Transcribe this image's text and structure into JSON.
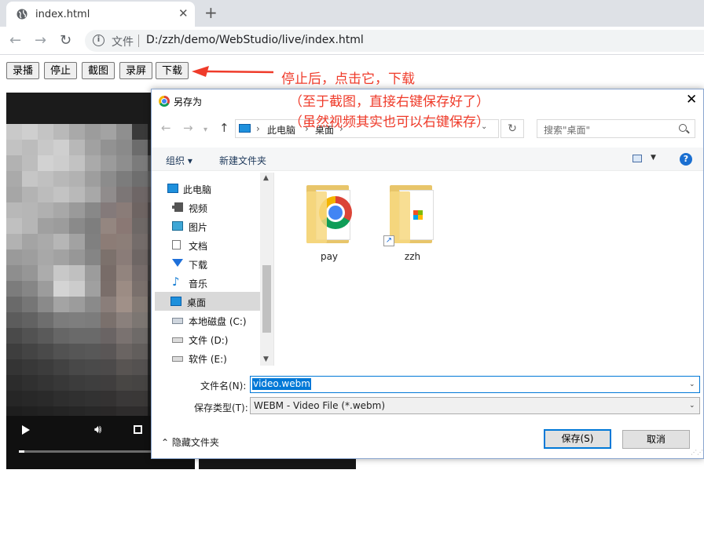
{
  "browser": {
    "tab_title": "index.html",
    "new_tab": "+",
    "scheme_label": "文件",
    "url": "D:/zzh/demo/WebStudio/live/index.html"
  },
  "page": {
    "buttons": [
      "录播",
      "停止",
      "截图",
      "录屏",
      "下载"
    ]
  },
  "annotation": {
    "lines": [
      "停止后，点击它，下载",
      "（至于截图，直接右键保存好了）",
      "（虽然视频其实也可以右键保存）"
    ],
    "color": "#ef3b2a"
  },
  "video": {
    "progress": 0.03,
    "mosaic": [
      "#c9c9c9",
      "#cfcfcf",
      "#c4c4c4",
      "#b9b9b9",
      "#a9a9a9",
      "#9c9c9c",
      "#a3a3a3",
      "#8f8f8f",
      "#3a3a3a",
      "#1c1c1c",
      "#c2c2c2",
      "#bcbcbc",
      "#c8c8c8",
      "#cfcfcf",
      "#b8b8b8",
      "#a1a1a1",
      "#929292",
      "#8a8a8a",
      "#6c6c6c",
      "#2a2a2a",
      "#b2b2b2",
      "#bdbdbd",
      "#d2d2d2",
      "#cdcdcd",
      "#c2c2c2",
      "#aaaaaa",
      "#9b9b9b",
      "#8e8e8e",
      "#7b7b7b",
      "#515151",
      "#aaaaaa",
      "#c6c6c6",
      "#c0c0c0",
      "#b8b8b8",
      "#b2b2b2",
      "#9e9e9e",
      "#8c8c8c",
      "#7c7c7c",
      "#6e6e6e",
      "#5c5c5c",
      "#a6a6a6",
      "#b3b3b3",
      "#bcbcbc",
      "#c3c3c3",
      "#b9b9b9",
      "#a8a8a8",
      "#908c8c",
      "#7c7676",
      "#6e6666",
      "#585252",
      "#b8b8b8",
      "#b6b6b6",
      "#b0b0b0",
      "#a8a8a8",
      "#9a9a9a",
      "#888888",
      "#847a7a",
      "#8a7c78",
      "#6e6462",
      "#4c4646",
      "#c0c0c0",
      "#b6b6b6",
      "#a0a0a0",
      "#9c9c9c",
      "#8a8a8a",
      "#7e7e7e",
      "#948680",
      "#8a7874",
      "#6e6866",
      "#4a4848",
      "#b2b2b2",
      "#a4a4a4",
      "#aaaaaa",
      "#b6b6b6",
      "#a2a2a2",
      "#808080",
      "#8c7c76",
      "#8c7e78",
      "#746c6a",
      "#4a4646",
      "#9a9a9a",
      "#9e9e9e",
      "#a8a8a8",
      "#a2a2a2",
      "#979797",
      "#858585",
      "#7c716c",
      "#8a7c78",
      "#6e6664",
      "#424040",
      "#8e8e8e",
      "#969696",
      "#acacac",
      "#c8c8c8",
      "#c0c0c0",
      "#9c9c9c",
      "#786c68",
      "#92847e",
      "#766c6a",
      "#3e3c3c",
      "#7c7c7c",
      "#868686",
      "#9c9c9c",
      "#d4d4d4",
      "#cccccc",
      "#a0a0a0",
      "#7a6e6a",
      "#9c8c84",
      "#7a706c",
      "#383636",
      "#6a6a6a",
      "#767676",
      "#8a8a8a",
      "#a4a4a4",
      "#9c9c9c",
      "#8a8a8a",
      "#8a7e7a",
      "#a09088",
      "#847a74",
      "#343232",
      "#5c5c5c",
      "#626262",
      "#6e6e6e",
      "#7c7c7c",
      "#7e7e7e",
      "#7c7c7c",
      "#7a706c",
      "#8a807c",
      "#7c7672",
      "#303030",
      "#4a4a4a",
      "#525252",
      "#5a5a5a",
      "#666666",
      "#6a6a6a",
      "#6a6a6a",
      "#6a6464",
      "#7a7270",
      "#6e6a68",
      "#2c2c2c",
      "#3e3e3e",
      "#444444",
      "#4a4a4a",
      "#525252",
      "#565656",
      "#585858",
      "#5a5656",
      "#6a6462",
      "#625e5c",
      "#282828",
      "#343434",
      "#383838",
      "#3c3c3c",
      "#424242",
      "#484848",
      "#4a4a4a",
      "#4c4a4a",
      "#585452",
      "#545150",
      "#242424",
      "#2c2c2c",
      "#303030",
      "#343434",
      "#383838",
      "#3c3c3c",
      "#3e3e3e",
      "#403e3e",
      "#484644",
      "#464443",
      "#202020",
      "#262626",
      "#282828",
      "#2a2a2a",
      "#2e2e2e",
      "#303030",
      "#323232",
      "#343232",
      "#3a3838",
      "#3a3837",
      "#1c1c1c",
      "#1e1e1e",
      "#202020",
      "#222222",
      "#242424",
      "#262626",
      "#282828",
      "#2a2828",
      "#2e2c2c",
      "#2e2c2c",
      "#181818"
    ]
  },
  "dialog": {
    "title": "另存为",
    "close": "✕",
    "address": [
      "此电脑",
      "桌面"
    ],
    "search_placeholder": "搜索\"桌面\"",
    "toolbar": {
      "organize": "组织 ▾",
      "new_folder": "新建文件夹",
      "help": "?"
    },
    "nav_items": [
      {
        "label": "此电脑",
        "icon": "pc-icon",
        "root": true
      },
      {
        "label": "视频",
        "icon": "video-icon"
      },
      {
        "label": "图片",
        "icon": "pictures-icon"
      },
      {
        "label": "文档",
        "icon": "documents-icon"
      },
      {
        "label": "下载",
        "icon": "download-icon"
      },
      {
        "label": "音乐",
        "icon": "music-icon"
      },
      {
        "label": "桌面",
        "icon": "desktop-icon",
        "selected": true
      },
      {
        "label": "本地磁盘 (C:)",
        "icon": "local-disk-icon"
      },
      {
        "label": "文件 (D:)",
        "icon": "drive-icon"
      },
      {
        "label": "软件 (E:)",
        "icon": "drive-icon"
      }
    ],
    "files": [
      {
        "label": "pay",
        "icon": "chrome-folder-icon"
      },
      {
        "label": "zzh",
        "icon": "shortcut-folder-icon"
      }
    ],
    "file_name_label": "文件名(N):",
    "file_name": "video.webm",
    "file_type_label": "保存类型(T):",
    "file_type": "WEBM - Video File (*.webm)",
    "hide_folders": "隐藏文件夹",
    "save": "保存(S)",
    "cancel": "取消"
  }
}
